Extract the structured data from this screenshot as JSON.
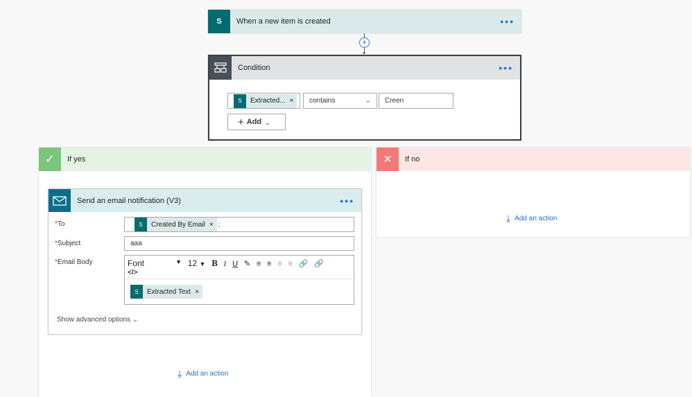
{
  "trigger": {
    "title": "When a new item is created",
    "icon": "sharepoint-icon",
    "more": "•••"
  },
  "condition": {
    "title": "Condition",
    "icon": "condition-icon",
    "more": "•••",
    "token": "Extracted...",
    "operator": "contains",
    "value": "Creen",
    "add_label": "Add"
  },
  "if_yes": {
    "title": "If yes",
    "color": "#5cb85c",
    "add_action": "Add an action"
  },
  "if_no": {
    "title": "If no",
    "color": "#f07878",
    "add_action": "Add an action"
  },
  "email": {
    "title": "Send an email notification (V3)",
    "more": "•••",
    "to_label": "To",
    "to_token": "Created By Email",
    "to_sep": ";",
    "subject_label": "Subject",
    "subject_value": "aaa",
    "body_label": "Email Body",
    "font": "Font",
    "font_size": "12",
    "code": "</>",
    "body_token": "Extracted Text",
    "advanced": "Show advanced options"
  },
  "required_mark": "*",
  "close": "×"
}
